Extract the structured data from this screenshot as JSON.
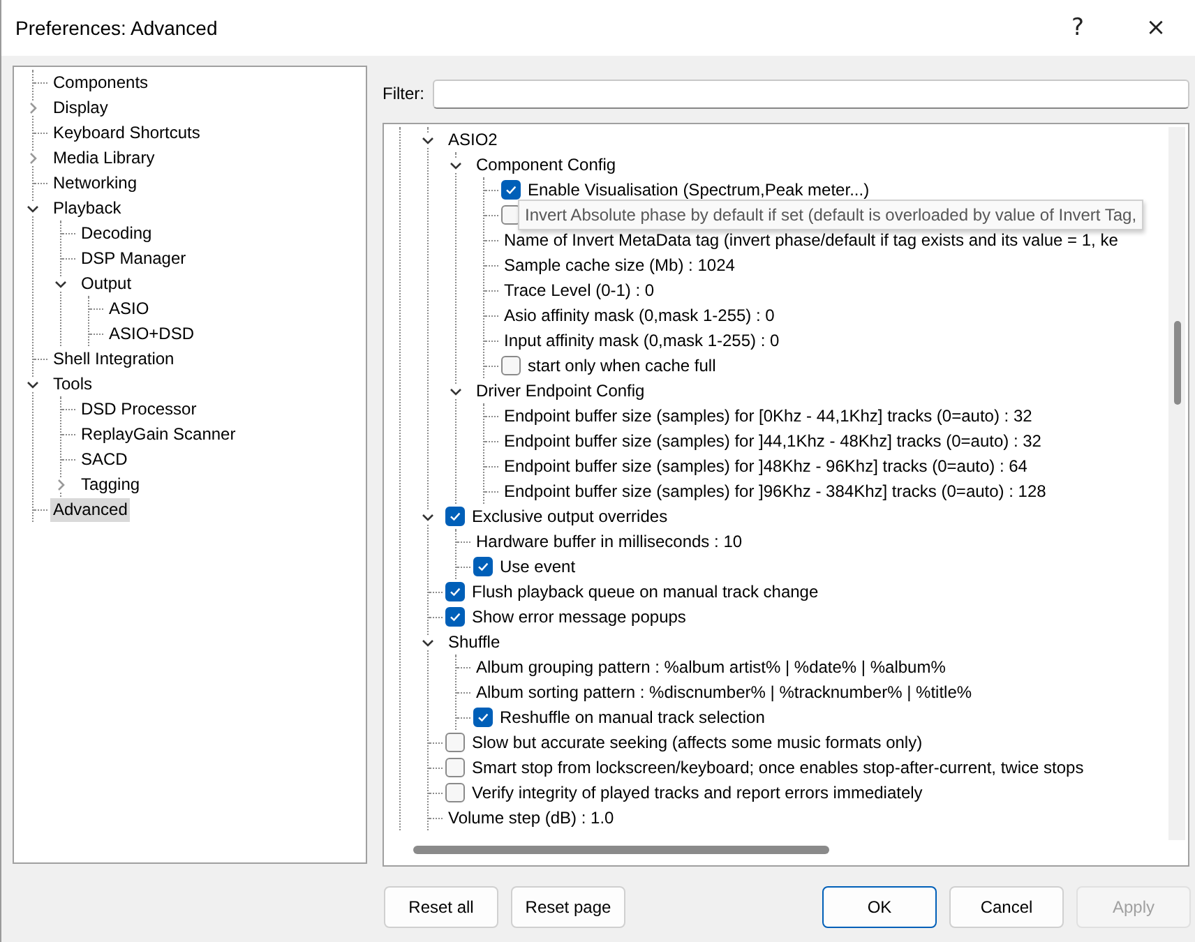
{
  "window": {
    "title": "Preferences: Advanced",
    "help_button": "?",
    "close_button": "×"
  },
  "sidebar": {
    "items": [
      {
        "label": "Components",
        "selected": false
      },
      {
        "label": "Display",
        "selected": false,
        "expanded": false
      },
      {
        "label": "Keyboard Shortcuts",
        "selected": false
      },
      {
        "label": "Media Library",
        "selected": false,
        "expanded": false
      },
      {
        "label": "Networking",
        "selected": false
      },
      {
        "label": "Playback",
        "selected": false,
        "expanded": true,
        "children": [
          {
            "label": "Decoding",
            "selected": false
          },
          {
            "label": "DSP Manager",
            "selected": false
          },
          {
            "label": "Output",
            "selected": false,
            "expanded": true,
            "children": [
              {
                "label": "ASIO",
                "selected": false
              },
              {
                "label": "ASIO+DSD",
                "selected": false
              }
            ]
          }
        ]
      },
      {
        "label": "Shell Integration",
        "selected": false
      },
      {
        "label": "Tools",
        "selected": false,
        "expanded": true,
        "children": [
          {
            "label": "DSD Processor",
            "selected": false
          },
          {
            "label": "ReplayGain Scanner",
            "selected": false
          },
          {
            "label": "SACD",
            "selected": false
          },
          {
            "label": "Tagging",
            "selected": false,
            "expanded": false
          }
        ]
      },
      {
        "label": "Advanced",
        "selected": true
      }
    ]
  },
  "filter": {
    "label": "Filter:"
  },
  "settings": {
    "items": [
      {
        "kind": "text",
        "label": "ASIO2",
        "expanded": true,
        "children": [
          {
            "kind": "text",
            "label": "Component Config",
            "expanded": true,
            "children": [
              {
                "kind": "check",
                "checked": true,
                "label": "Enable Visualisation (Spectrum,Peak meter...)"
              },
              {
                "kind": "check",
                "checked": false
              },
              {
                "kind": "text",
                "label": "Name of Invert MetaData tag (invert phase/default if tag exists and its value = 1, ke"
              },
              {
                "kind": "text",
                "label": "Sample cache size (Mb) : 1024"
              },
              {
                "kind": "text",
                "label": "Trace Level (0-1) : 0"
              },
              {
                "kind": "text",
                "label": "Asio affinity mask (0,mask 1-255) : 0"
              },
              {
                "kind": "text",
                "label": "Input affinity mask (0,mask 1-255) : 0"
              },
              {
                "kind": "check",
                "checked": false,
                "label": "start only when cache full"
              }
            ]
          },
          {
            "kind": "text",
            "label": "Driver Endpoint Config",
            "expanded": true,
            "children": [
              {
                "kind": "text",
                "label": "Endpoint buffer size (samples) for [0Khz - 44,1Khz] tracks (0=auto) : 32"
              },
              {
                "kind": "text",
                "label": "Endpoint buffer size (samples) for ]44,1Khz - 48Khz] tracks (0=auto) : 32"
              },
              {
                "kind": "text",
                "label": "Endpoint buffer size (samples) for ]48Khz - 96Khz] tracks (0=auto) : 64"
              },
              {
                "kind": "text",
                "label": "Endpoint buffer size (samples) for ]96Khz - 384Khz] tracks (0=auto) : 128"
              }
            ]
          }
        ]
      },
      {
        "kind": "check",
        "checked": true,
        "label": "Exclusive output overrides",
        "expanded": true,
        "children": [
          {
            "kind": "text",
            "label": "Hardware buffer in milliseconds : 10"
          },
          {
            "kind": "check",
            "checked": true,
            "label": "Use event"
          }
        ]
      },
      {
        "kind": "check",
        "checked": true,
        "label": "Flush playback queue on manual track change"
      },
      {
        "kind": "check",
        "checked": true,
        "label": "Show error message popups"
      },
      {
        "kind": "text",
        "label": "Shuffle",
        "expanded": true,
        "children": [
          {
            "kind": "text",
            "label": "Album grouping pattern : %album artist% | %date% | %album%"
          },
          {
            "kind": "text",
            "label": "Album sorting pattern : %discnumber% | %tracknumber% | %title%"
          },
          {
            "kind": "check",
            "checked": true,
            "label": "Reshuffle on manual track selection"
          }
        ]
      },
      {
        "kind": "check",
        "checked": false,
        "label": "Slow but accurate seeking (affects some music formats only)"
      },
      {
        "kind": "check",
        "checked": false,
        "label": "Smart stop from lockscreen/keyboard; once enables stop-after-current, twice stops"
      },
      {
        "kind": "check",
        "checked": false,
        "label": "Verify integrity of played tracks and report errors immediately"
      },
      {
        "kind": "text",
        "label": "Volume step (dB) : 1.0"
      }
    ]
  },
  "tooltip": "Invert Absolute phase by default if set (default is overloaded by value of Invert Tag,",
  "buttons": [
    {
      "label": "Reset all",
      "kind": "left",
      "focused": false,
      "disabled": false
    },
    {
      "label": "Reset page",
      "kind": "left",
      "focused": false,
      "disabled": false
    },
    {
      "label": "OK",
      "kind": "right",
      "focused": true,
      "disabled": false
    },
    {
      "label": "Cancel",
      "kind": "right",
      "focused": false,
      "disabled": false
    },
    {
      "label": "Apply",
      "kind": "right",
      "focused": false,
      "disabled": true
    }
  ]
}
